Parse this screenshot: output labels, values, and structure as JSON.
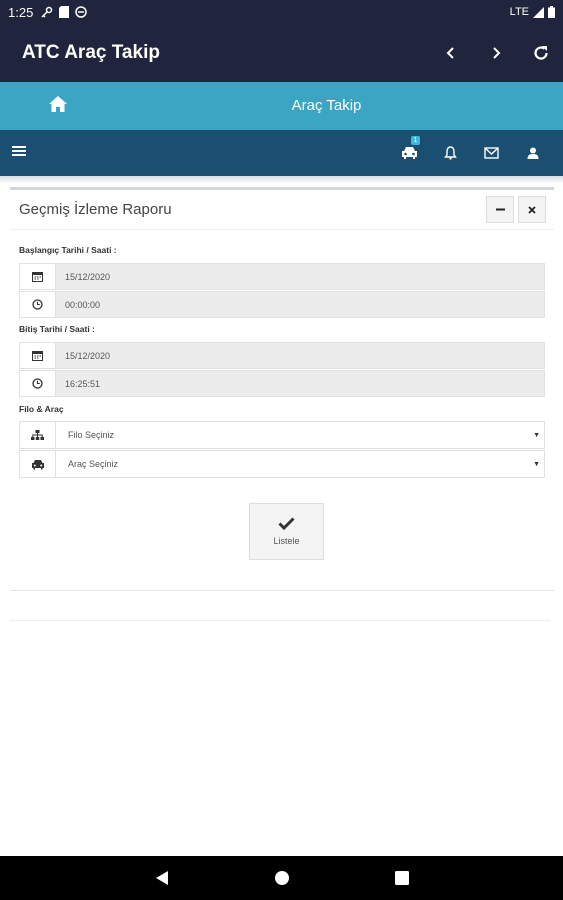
{
  "status_bar": {
    "time": "1:25",
    "network": "LTE"
  },
  "app_bar": {
    "title": "ATC Araç Takip"
  },
  "teal_bar": {
    "title": "Araç Takip"
  },
  "nav_bar": {
    "vehicle_badge": "1"
  },
  "panel": {
    "title": "Geçmiş İzleme Raporu",
    "start_label": "Başlangıç Tarihi / Saati :",
    "start_date": "15/12/2020",
    "start_time": "00:00:00",
    "end_label": "Bitiş Tarihi / Saati :",
    "end_date": "15/12/2020",
    "end_time": "16:25:51",
    "fleet_label": "Filo & Araç",
    "fleet_select": "Filo Seçiniz",
    "vehicle_select": "Araç Seçiniz",
    "list_button": "Listele"
  },
  "colors": {
    "app_bar": "#20243d",
    "teal": "#3aa6c4",
    "nav": "#1b4f72"
  }
}
